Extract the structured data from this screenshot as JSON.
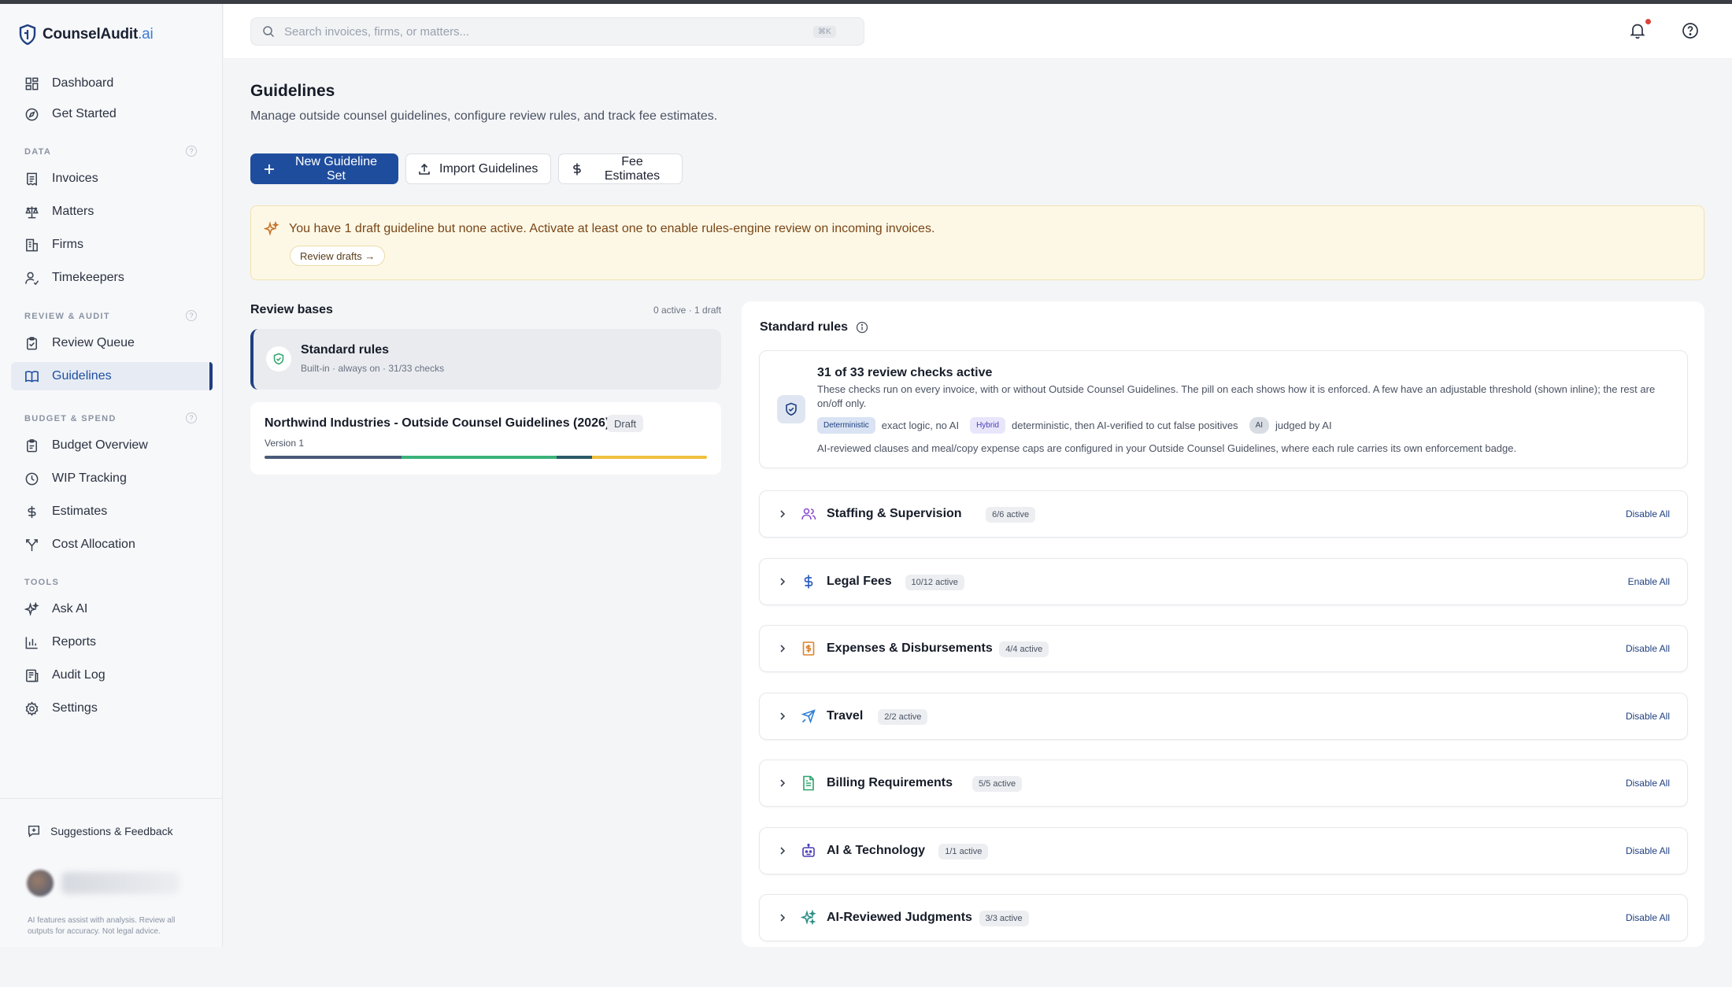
{
  "app": {
    "name": "CounselAudit",
    "name_suffix": ".ai"
  },
  "sidebar": {
    "top_items": [
      {
        "label": "Dashboard",
        "icon": "dashboard-icon"
      },
      {
        "label": "Get Started",
        "icon": "compass-icon"
      }
    ],
    "sections": [
      {
        "label": "DATA",
        "items": [
          "Invoices",
          "Matters",
          "Firms",
          "Timekeepers"
        ]
      },
      {
        "label": "REVIEW & AUDIT",
        "items": [
          "Review Queue",
          "Guidelines"
        ]
      },
      {
        "label": "BUDGET & SPEND",
        "items": [
          "Budget Overview",
          "WIP Tracking",
          "Estimates",
          "Cost Allocation"
        ]
      },
      {
        "label": "TOOLS",
        "items": [
          "Ask AI",
          "Reports",
          "Audit Log",
          "Settings"
        ]
      }
    ],
    "active_item": "Guidelines",
    "feedback_label": "Suggestions & Feedback",
    "disclaimer": "AI features assist with analysis. Review all outputs for accuracy. Not legal advice."
  },
  "header": {
    "search_placeholder": "Search invoices, firms, or matters...",
    "search_shortcut": "⌘K"
  },
  "page": {
    "title": "Guidelines",
    "subtitle": "Manage outside counsel guidelines, configure review rules, and track fee estimates.",
    "buttons": {
      "new_set": "New Guideline Set",
      "import": "Import Guidelines",
      "fee_estimates": "Fee Estimates"
    },
    "alert": {
      "text": "You have 1 draft guideline but none active. Activate at least one to enable rules-engine review on incoming invoices.",
      "link": "Review drafts →"
    }
  },
  "review_bases": {
    "title": "Review bases",
    "count": "0 active · 1 draft",
    "standard": {
      "name": "Standard rules",
      "meta": "Built-in · always on · 31/33 checks"
    },
    "northwind": {
      "name": "Northwind Industries - Outside Counsel Guidelines (2026)",
      "badge": "Draft",
      "version": "Version 1",
      "segments": [
        {
          "fraction": 0.31,
          "color": "#4a5a78"
        },
        {
          "fraction": 0.35,
          "color": "#3bb27a"
        },
        {
          "fraction": 0.08,
          "color": "#2b5a67"
        },
        {
          "fraction": 0.26,
          "color": "#f0c03c"
        }
      ]
    }
  },
  "standard_rules": {
    "title": "Standard rules",
    "summary": {
      "title": "31 of 33 review checks active",
      "desc": "These checks run on every invoice, with or without Outside Counsel Guidelines. The pill on each shows how it is enforced. A few have an adjustable threshold (shown inline); the rest are on/off only.",
      "legend": [
        {
          "pill": "Deterministic",
          "text": "exact logic, no AI",
          "kind": "det"
        },
        {
          "pill": "Hybrid",
          "text": "deterministic, then AI-verified to cut false positives",
          "kind": "hyb"
        },
        {
          "pill": "AI",
          "text": "judged by AI",
          "kind": "ai"
        }
      ],
      "note": "AI-reviewed clauses and meal/copy expense caps are configured in your Outside Counsel Guidelines, where each rule carries its own enforcement badge."
    },
    "categories": [
      {
        "label": "Staffing & Supervision",
        "badge": "6/6 active",
        "action": "Disable All",
        "icon": "people-icon",
        "color": "#8a4fd1"
      },
      {
        "label": "Legal Fees",
        "badge": "10/12 active",
        "action": "Enable All",
        "icon": "dollar-icon",
        "color": "#2f5fc4"
      },
      {
        "label": "Expenses & Disbursements",
        "badge": "4/4 active",
        "action": "Disable All",
        "icon": "receipt-icon",
        "color": "#d9822b"
      },
      {
        "label": "Travel",
        "badge": "2/2 active",
        "action": "Disable All",
        "icon": "plane-icon",
        "color": "#2f7fd6"
      },
      {
        "label": "Billing Requirements",
        "badge": "5/5 active",
        "action": "Disable All",
        "icon": "document-icon",
        "color": "#2fa36a"
      },
      {
        "label": "AI & Technology",
        "badge": "1/1 active",
        "action": "Disable All",
        "icon": "robot-icon",
        "color": "#4a3fb8"
      },
      {
        "label": "AI-Reviewed Judgments",
        "badge": "3/3 active",
        "action": "Disable All",
        "icon": "sparkle-icon",
        "color": "#2c8f86"
      }
    ]
  }
}
